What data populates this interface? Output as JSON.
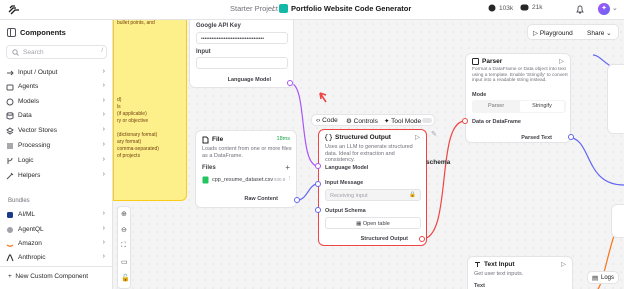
{
  "topbar": {
    "project": "Starter Project",
    "separator": "/",
    "flow_name": "Portfolio Website Code Generator",
    "github_count": "103k",
    "discord_count": "21k",
    "avatar_initial": "✦"
  },
  "sidebar": {
    "title": "Components",
    "search_placeholder": "Search",
    "search_shortcut": "/",
    "items": [
      {
        "label": "Input / Output",
        "icon": "input-output-icon"
      },
      {
        "label": "Agents",
        "icon": "bot-icon"
      },
      {
        "label": "Models",
        "icon": "brain-icon"
      },
      {
        "label": "Data",
        "icon": "database-icon"
      },
      {
        "label": "Vector Stores",
        "icon": "layers-icon"
      },
      {
        "label": "Processing",
        "icon": "list-icon"
      },
      {
        "label": "Logic",
        "icon": "branch-icon"
      },
      {
        "label": "Helpers",
        "icon": "wand-icon"
      }
    ],
    "bundles_label": "Bundles",
    "bundles": [
      {
        "label": "AI/ML"
      },
      {
        "label": "AgentQL"
      },
      {
        "label": "Amazon"
      },
      {
        "label": "Anthropic"
      }
    ],
    "new_component": "New Custom Component"
  },
  "canvas": {
    "playground": "Playground",
    "share": "Share",
    "logs": "Logs",
    "yellow_note": {
      "lines": [
        "bullet points, and",
        "",
        "",
        "",
        "",
        "",
        "",
        "",
        "",
        "d)",
        "ls",
        "(if applicable)",
        "ry or objective",
        "",
        "(dictionary format)",
        "ary format)",
        "comma-separated)",
        "of projects"
      ]
    },
    "llm_node": {
      "api_key_label": "Google API Key",
      "api_key_value": "••••••••••••••••••••••••••••••••••••",
      "input_label": "Input",
      "output_label": "Language Model"
    },
    "file_node": {
      "title": "File",
      "badge": "18ms",
      "description": "Loads content from one or more files as a DataFrame.",
      "files_label": "Files",
      "file_name": "cpp_resume_dataset.csv",
      "file_size": "930.8",
      "output_label": "Raw Content"
    },
    "structured_node": {
      "toolbar_code": "Code",
      "toolbar_controls": "Controls",
      "toolbar_tool_mode": "Tool Mode",
      "title": "Structured Output",
      "description": "Uses an LLM to generate structured data. Ideal for extraction and consistency.",
      "language_model_label": "Language Model",
      "input_message_label": "Input Message",
      "input_message_value": "Receiving input",
      "schema_label": "Output Schema",
      "open_table": "Open table",
      "output_label": "Structured Output"
    },
    "parser_node": {
      "title": "Parser",
      "description": "Format a DataFrame or Data object into text using a template. Enable 'Stringify' to convert input into a readable string instead.",
      "mode_label": "Mode",
      "mode_parser": "Parser",
      "mode_stringify": "Stringify",
      "input_label": "Data or DataFrame",
      "output_label": "Parsed Text"
    },
    "text_input_node": {
      "title": "Text Input",
      "description": "Get user text inputs.",
      "text_label": "Text"
    },
    "edge_label": "schema"
  },
  "colors": {
    "accent_red": "#ef4444",
    "port_purple": "#a855f7",
    "port_blue": "#6366f1",
    "note_yellow": "#fdf08a"
  }
}
